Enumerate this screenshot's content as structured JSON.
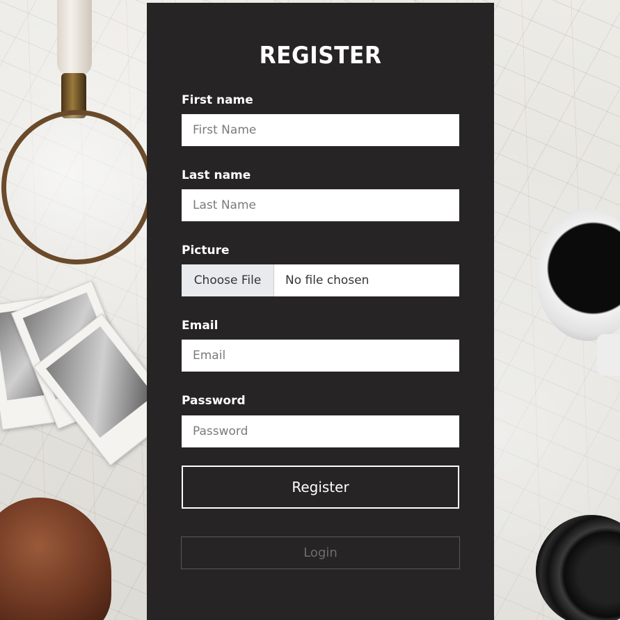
{
  "form": {
    "title": "REGISTER",
    "fields": {
      "first_name": {
        "label": "First name",
        "placeholder": "First Name",
        "value": ""
      },
      "last_name": {
        "label": "Last name",
        "placeholder": "Last Name",
        "value": ""
      },
      "picture": {
        "label": "Picture",
        "button_label": "Choose File",
        "status": "No file chosen"
      },
      "email": {
        "label": "Email",
        "placeholder": "Email",
        "value": ""
      },
      "password": {
        "label": "Password",
        "placeholder": "Password",
        "value": ""
      }
    },
    "register_label": "Register",
    "login_label": "Login"
  },
  "colors": {
    "panel": "#262424",
    "text": "#ffffff",
    "input_bg": "#ffffff",
    "login_text": "#6f6d6d"
  }
}
